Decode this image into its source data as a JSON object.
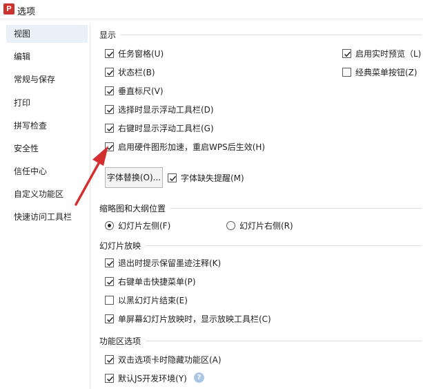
{
  "window": {
    "title": "选项",
    "icon": "wps-presentation-icon",
    "icon_letter": "P"
  },
  "sidebar": {
    "items": [
      {
        "label": "视图",
        "selected": true
      },
      {
        "label": "编辑",
        "selected": false
      },
      {
        "label": "常规与保存",
        "selected": false
      },
      {
        "label": "打印",
        "selected": false
      },
      {
        "label": "拼写检查",
        "selected": false
      },
      {
        "label": "安全性",
        "selected": false
      },
      {
        "label": "信任中心",
        "selected": false
      },
      {
        "label": "自定义功能区",
        "selected": false
      },
      {
        "label": "快速访问工具栏",
        "selected": false
      }
    ]
  },
  "display": {
    "title": "显示",
    "left": [
      {
        "label": "任务窗格(U)",
        "checked": true
      },
      {
        "label": "状态栏(B)",
        "checked": true
      },
      {
        "label": "垂直标尺(V)",
        "checked": true
      },
      {
        "label": "选择时显示浮动工具栏(D)",
        "checked": true
      },
      {
        "label": "右键时显示浮动工具栏(G)",
        "checked": true
      },
      {
        "label": "启用硬件图形加速，重启WPS后生效(H)",
        "checked": true
      }
    ],
    "right": [
      {
        "label": "启用实时预览（L)",
        "checked": true
      },
      {
        "label": "经典菜单按钮(Z)",
        "checked": false
      }
    ],
    "font_replace_button": "字体替换(O)...",
    "font_missing": {
      "label": "字体缺失提醒(M)",
      "checked": true
    }
  },
  "thumbnail": {
    "title": "缩略图和大纲位置",
    "options": [
      {
        "label": "幻灯片左侧(F)",
        "selected": true
      },
      {
        "label": "幻灯片右侧(R)",
        "selected": false
      }
    ]
  },
  "slideshow": {
    "title": "幻灯片放映",
    "items": [
      {
        "label": "退出时提示保留墨迹注释(K)",
        "checked": true
      },
      {
        "label": "右键单击快捷菜单(P)",
        "checked": true
      },
      {
        "label": "以黑幻灯片结束(E)",
        "checked": false
      },
      {
        "label": "单屏幕幻灯片放映时，显示放映工具栏(C)",
        "checked": true
      }
    ]
  },
  "ribbon": {
    "title": "功能区选项",
    "items": [
      {
        "label": "双击选项卡时隐藏功能区(A)",
        "checked": true
      },
      {
        "label": "默认JS开发环境(Y)",
        "checked": true
      }
    ],
    "help_icon_text": "?"
  },
  "colors": {
    "accent_selected": "#e9f0f8",
    "app_icon": "#c9342c",
    "annotation_arrow": "#d32f2f",
    "help_icon": "#a9c6e6"
  }
}
